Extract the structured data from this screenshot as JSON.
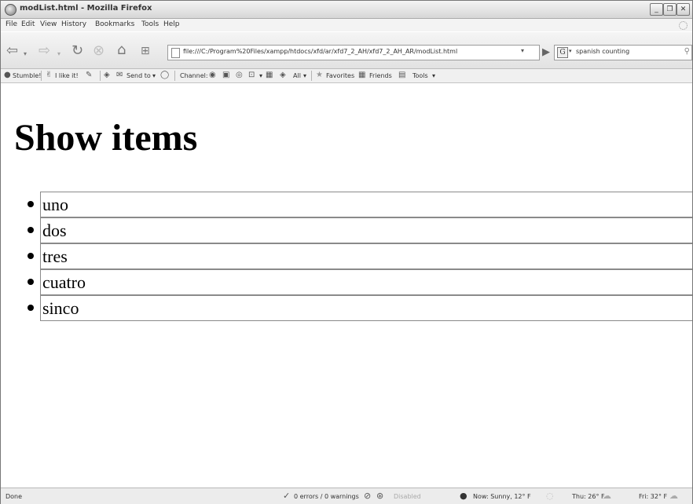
{
  "window": {
    "title": "modList.html - Mozilla Firefox"
  },
  "menu": {
    "items": [
      "File",
      "Edit",
      "View",
      "History",
      "Bookmarks",
      "Tools",
      "Help"
    ]
  },
  "nav": {
    "url": "file:///C:/Program%20Files/xampp/htdocs/xfd/ar/xfd7_2_AH/xfd7_2_AH_AR/modList.html",
    "search_engine_glyph": "G",
    "search_text": "spanish counting"
  },
  "extensions": {
    "stumble": "Stumble!",
    "like": "I like it!",
    "send_to": "Send to",
    "channel": "Channel:",
    "all": "All",
    "favorites": "Favorites",
    "friends": "Friends",
    "tools": "Tools"
  },
  "page": {
    "heading": "Show items",
    "items": [
      "uno",
      "dos",
      "tres",
      "cuatro",
      "sinco"
    ]
  },
  "status": {
    "done": "Done",
    "errors": "0 errors / 0 warnings",
    "disabled": "Disabled",
    "weather_now": "Now: Sunny, 12° F",
    "weather_thu": "Thu: 26° F",
    "weather_fri": "Fri: 32° F"
  },
  "icons": {
    "app": "firefox-icon",
    "back": "back-arrow-icon",
    "forward": "forward-arrow-icon",
    "reload": "reload-icon",
    "stop": "stop-icon",
    "home": "home-icon",
    "go": "go-icon",
    "search": "magnifier-icon"
  }
}
